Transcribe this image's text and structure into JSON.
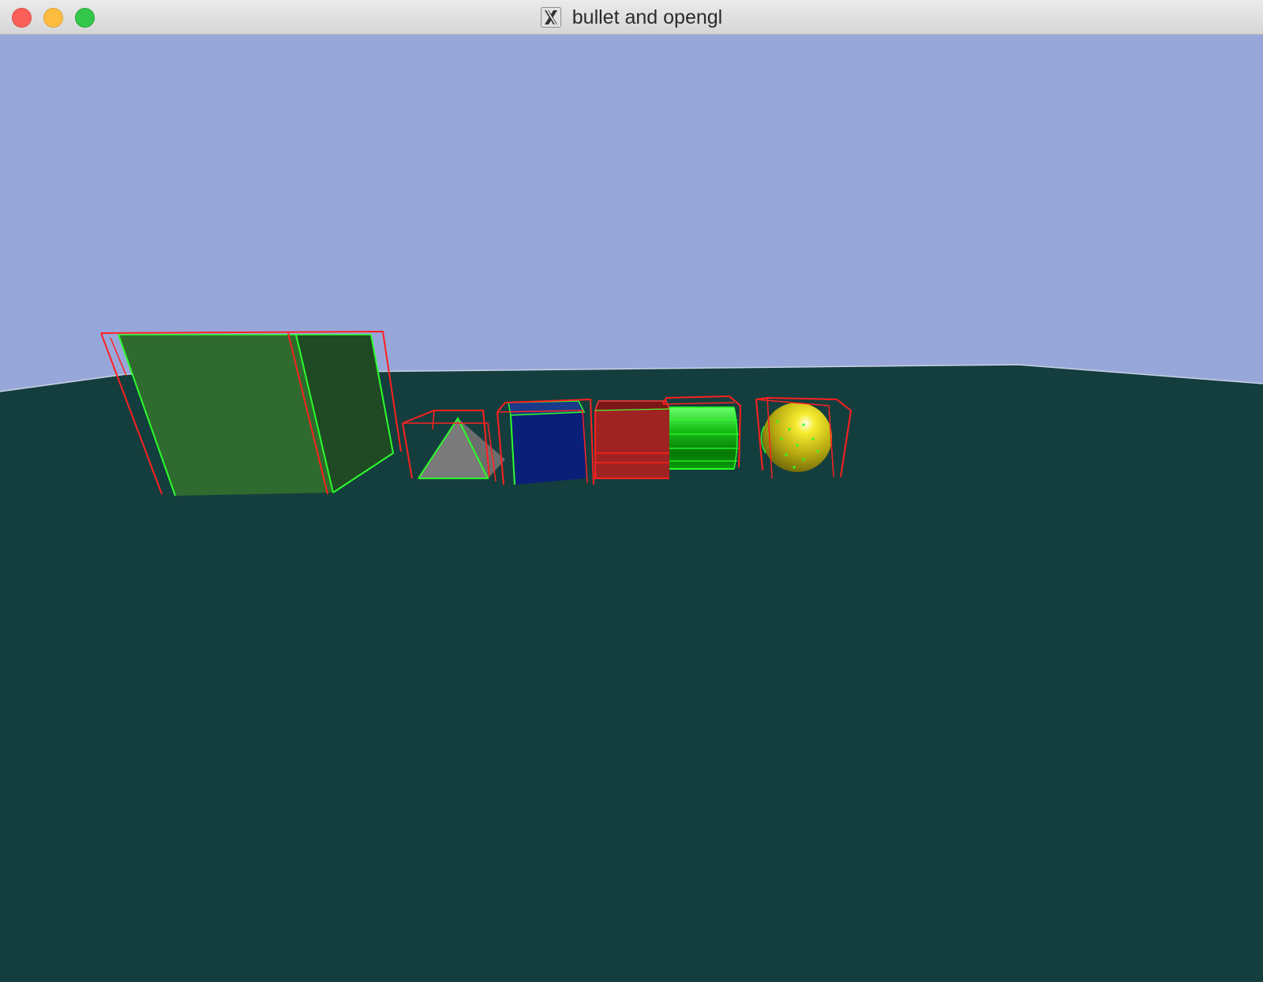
{
  "window": {
    "title": "bullet and opengl",
    "app_icon": "x11-icon"
  },
  "scene": {
    "sky_color": "#98a7da",
    "ground_color": "#143e3e",
    "wireframe_color": "#ff2020",
    "edge_color": "#2bff2b",
    "objects": [
      {
        "name": "large-box",
        "color": "#2f6b2f"
      },
      {
        "name": "pyramid",
        "color": "#7a7a7a"
      },
      {
        "name": "blue-box",
        "color": "#0a1f78"
      },
      {
        "name": "red-box",
        "color": "#a02323"
      },
      {
        "name": "cylinder",
        "color": "#12b012"
      },
      {
        "name": "sphere",
        "color": "#d4c81c"
      }
    ]
  }
}
